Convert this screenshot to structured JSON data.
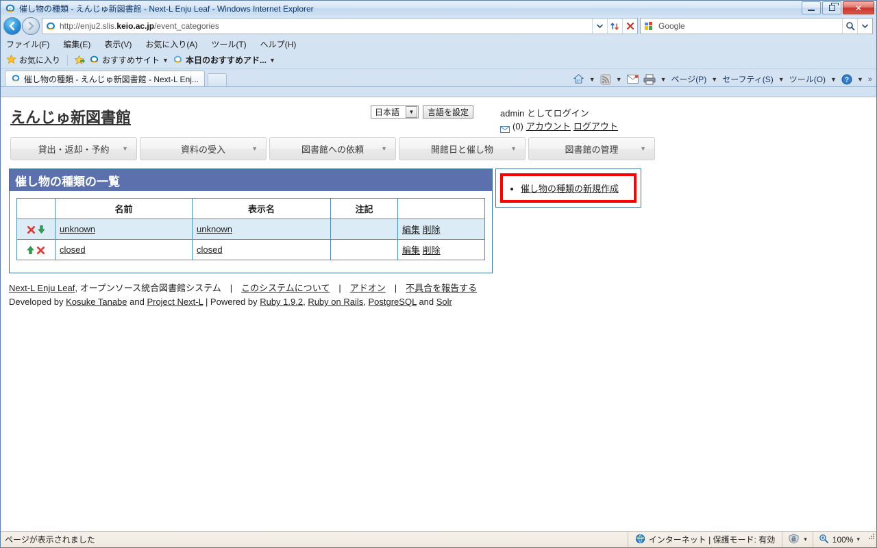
{
  "window": {
    "title": "催し物の種類 - えんじゅ新図書館 - Next-L Enju Leaf - Windows Internet Explorer",
    "minimize_label": "",
    "restore_label": "",
    "close_label": "✕"
  },
  "address": {
    "url_prefix": "http://enju2.slis.",
    "url_bold": "keio.ac.jp",
    "url_suffix": "/event_categories",
    "dropdown_icon": "chevron-down-icon",
    "refresh_icon": "refresh-icon",
    "stop_icon": "stop-icon"
  },
  "search": {
    "provider": "Google",
    "search_icon": "search-icon",
    "dropdown_icon": "chevron-down-icon"
  },
  "menubar": {
    "items": [
      "ファイル(F)",
      "編集(E)",
      "表示(V)",
      "お気に入り(A)",
      "ツール(T)",
      "ヘルプ(H)"
    ]
  },
  "favbar": {
    "favorites_label": "お気に入り",
    "items": [
      {
        "label": "おすすめサイト",
        "bold": false,
        "has_caret": true
      },
      {
        "label": "本日のおすすめアド...",
        "bold": true,
        "has_caret": true
      }
    ]
  },
  "tabs": [
    {
      "label": "催し物の種類 - えんじゅ新図書館 - Next-L Enj...",
      "active": true
    }
  ],
  "commandbar": {
    "items": [
      {
        "icon": "home-icon",
        "label": "",
        "caret": true
      },
      {
        "icon": "feeds-icon",
        "label": "",
        "caret": true
      },
      {
        "icon": "mail-icon",
        "label": "",
        "caret": false
      },
      {
        "icon": "print-icon",
        "label": "",
        "caret": true
      },
      {
        "icon": "page-icon",
        "label": "ページ(P)",
        "caret": true
      },
      {
        "icon": "safety-icon",
        "label": "セーフティ(S)",
        "caret": true
      },
      {
        "icon": "tools-icon",
        "label": "ツール(O)",
        "caret": true
      },
      {
        "icon": "help-icon",
        "label": "",
        "caret": true
      }
    ],
    "overflow": "»"
  },
  "site": {
    "title": "えんじゅ新図書館",
    "language": {
      "selected": "日本語",
      "dropdown_icon": "chevron-down-icon",
      "set_button": "言語を設定"
    },
    "account": {
      "user": "admin",
      "logged_in_suffix": " としてログイン",
      "message_icon": "mail-icon",
      "message_count": "(0)",
      "account_link": "アカウント",
      "logout_link": "ログアウト"
    },
    "nav": [
      {
        "label": "貸出・返却・予約"
      },
      {
        "label": "資料の受入"
      },
      {
        "label": "図書館への依頼"
      },
      {
        "label": "開館日と催し物"
      },
      {
        "label": "図書館の管理"
      }
    ]
  },
  "main": {
    "panel_title": "催し物の種類の一覧",
    "table": {
      "headers": [
        "",
        "名前",
        "表示名",
        "注記",
        ""
      ],
      "rows": [
        {
          "icons": [
            "delete-x-icon",
            "move-down-icon"
          ],
          "name": "unknown",
          "display_name": "unknown",
          "note": "",
          "edit": "編集",
          "delete": "削除"
        },
        {
          "icons": [
            "move-up-icon",
            "delete-x-icon"
          ],
          "name": "closed",
          "display_name": "closed",
          "note": "",
          "edit": "編集",
          "delete": "削除"
        }
      ]
    }
  },
  "sidebar": {
    "links": [
      {
        "label": "催し物の種類の新規作成"
      }
    ]
  },
  "footer": {
    "line1": [
      {
        "text": "Next-L Enju Leaf",
        "link": true
      },
      {
        "text": ", オープンソース統合図書館システム　|　",
        "link": false
      },
      {
        "text": "このシステムについて",
        "link": true
      },
      {
        "text": "　|　",
        "link": false
      },
      {
        "text": "アドオン",
        "link": true
      },
      {
        "text": "　|　",
        "link": false
      },
      {
        "text": "不具合を報告する",
        "link": true
      }
    ],
    "line2": [
      {
        "text": "Developed by ",
        "link": false
      },
      {
        "text": "Kosuke Tanabe",
        "link": true
      },
      {
        "text": " and ",
        "link": false
      },
      {
        "text": "Project Next-L",
        "link": true
      },
      {
        "text": " | Powered by ",
        "link": false
      },
      {
        "text": "Ruby 1.9.2",
        "link": true
      },
      {
        "text": ", ",
        "link": false
      },
      {
        "text": "Ruby on Rails",
        "link": true
      },
      {
        "text": ", ",
        "link": false
      },
      {
        "text": "PostgreSQL",
        "link": true
      },
      {
        "text": " and ",
        "link": false
      },
      {
        "text": "Solr",
        "link": true
      }
    ]
  },
  "statusbar": {
    "message": "ページが表示されました",
    "zone_icon": "globe-icon",
    "zone": "インターネット | 保護モード: 有効",
    "security_icon": "security-icon",
    "zoom_icon": "zoom-icon",
    "zoom": "100%",
    "caret": "▾"
  },
  "colors": {
    "panel_header": "#5b70ac",
    "panel_border": "#3d7496",
    "row_alt": "#dcecf7",
    "highlight": "#ff0000"
  }
}
